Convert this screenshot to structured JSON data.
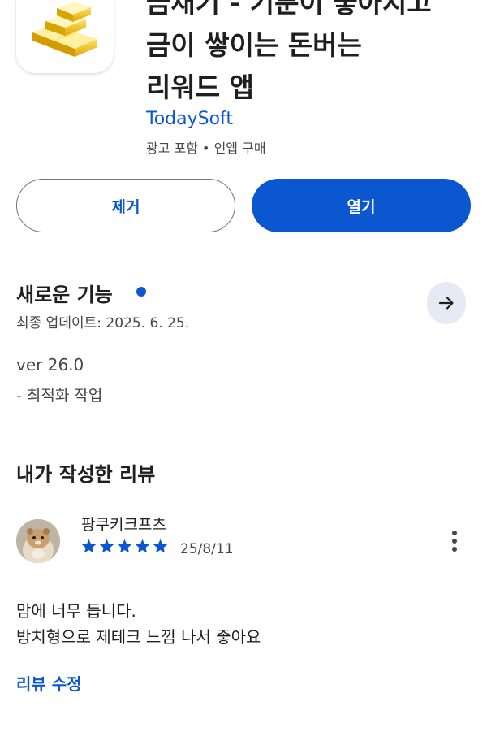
{
  "app": {
    "title": "금채기 - 기분이 좋아지고\n금이 쌓이는 돈버는\n리워드 앱",
    "developer": "TodaySoft",
    "meta": "광고 포함 • 인앱 구매"
  },
  "actions": {
    "remove_label": "제거",
    "open_label": "열기"
  },
  "whats_new": {
    "title": "새로운 기능",
    "updated": "최종 업데이트: 2025. 6. 25.",
    "version": "ver 26.0",
    "changes": "- 최적화 작업"
  },
  "my_review": {
    "title": "내가 작성한 리뷰",
    "author": "팡쿠키크프츠",
    "rating": 5,
    "date": "25/8/11",
    "text_line1": "맘에 너무 듭니다.",
    "text_line2": "방치형으로 제테크 느낌 나서 좋아요",
    "edit_label": "리뷰 수정"
  },
  "colors": {
    "accent": "#0b57d0",
    "text": "#1f1f1f",
    "secondary": "#444746",
    "icon_bg": "#e6eaf2"
  },
  "icons": {
    "app": "gold-bars-icon",
    "arrow": "arrow-right-icon",
    "more": "more-vert-icon",
    "star": "star-icon"
  }
}
